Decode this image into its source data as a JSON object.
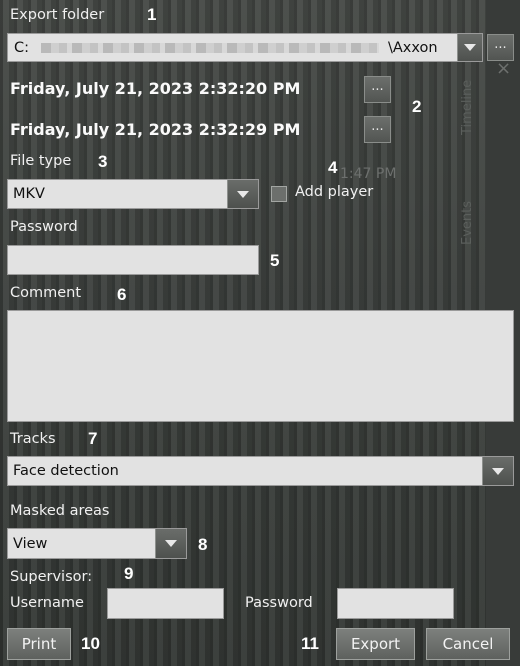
{
  "export_folder": {
    "label": "Export folder",
    "path_start": "C:",
    "path_end": "\\Axxon",
    "browse_label": "..."
  },
  "dates": {
    "start": "Friday, July 21, 2023 2:32:20 PM",
    "end": "Friday, July 21, 2023 2:32:29 PM",
    "button_label": "..."
  },
  "file_type": {
    "label": "File type",
    "value": "MKV"
  },
  "add_player": {
    "label": "Add player",
    "checked": false
  },
  "password": {
    "label": "Password",
    "value": ""
  },
  "comment": {
    "label": "Comment",
    "value": ""
  },
  "tracks": {
    "label": "Tracks",
    "value": "Face detection"
  },
  "masked_areas": {
    "label": "Masked areas",
    "value": "View"
  },
  "supervisor": {
    "label": "Supervisor:",
    "username_label": "Username",
    "username_value": "",
    "password_label": "Password",
    "password_value": ""
  },
  "buttons": {
    "print": "Print",
    "export": "Export",
    "cancel": "Cancel"
  },
  "callouts": [
    "1",
    "2",
    "3",
    "4",
    "5",
    "6",
    "7",
    "8",
    "9",
    "10",
    "11"
  ],
  "background": {
    "timeline_label": "Timeline",
    "events_label": "Events",
    "time_ghost": "1:47 PM",
    "close_glyph": "×"
  },
  "colors": {
    "field": "#e2e2e2",
    "panel": "#3c3f3d",
    "button": "#6e716e"
  }
}
